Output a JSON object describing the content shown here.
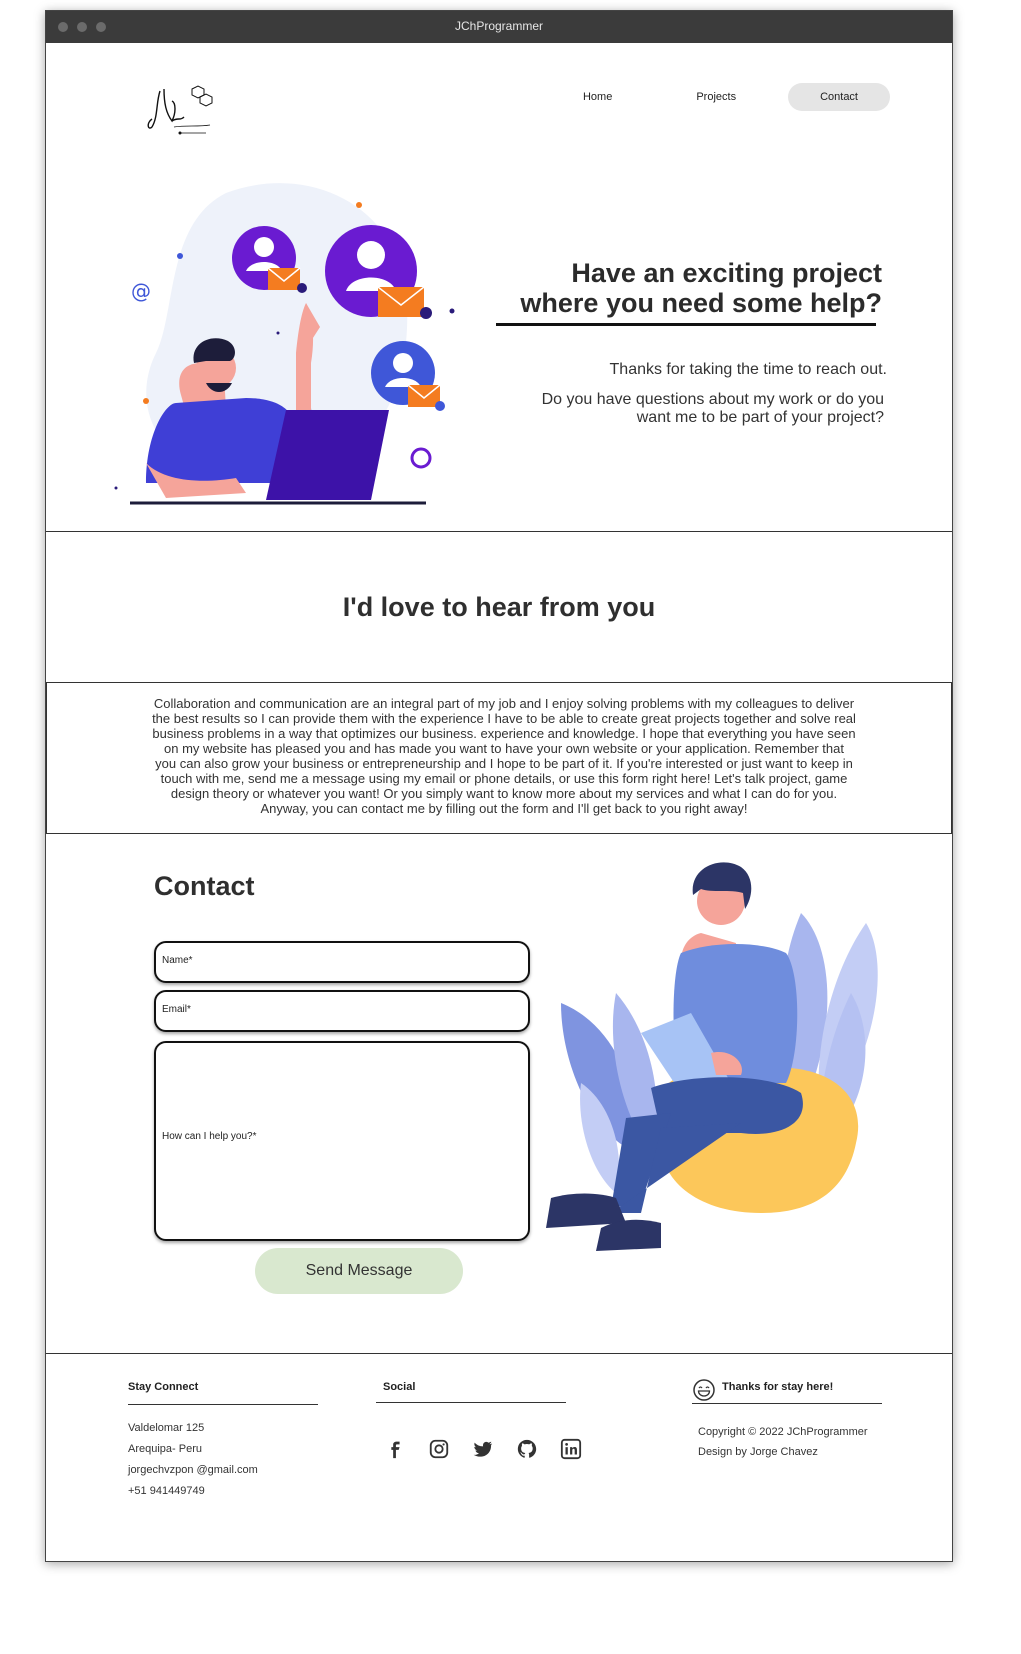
{
  "window": {
    "title": "JChProgrammer"
  },
  "nav": {
    "items": [
      {
        "label": "Home"
      },
      {
        "label": "Projects"
      },
      {
        "label": "Contact"
      }
    ]
  },
  "hero": {
    "title_line1": "Have an exciting project",
    "title_line2": "where you need some help?",
    "subtitle": "Thanks for taking the time to reach out.",
    "question": "Do you have questions about my work or do you want me to be part of your project?"
  },
  "intro": {
    "heading": "I'd love to hear from you",
    "paragraph": "Collaboration and communication are an integral part of my job and I enjoy solving problems with my colleagues to deliver the best results so I can provide them with the experience I have to be able to create great projects together and solve real business problems in a way that optimizes our business. experience and knowledge. I hope that everything you have seen on my website has pleased you and has made you want to have your own website or your application. Remember that you can also grow your business or entrepreneurship and I hope to be part of it. If you're interested or just want to keep in touch with me, send me a message using my email or phone details, or use this form right here! Let's talk project, game design theory or whatever you want! Or you simply want to know more about my services and what I can do for you. Anyway, you can contact me by filling out the form and I'll get back to you right away!"
  },
  "contact": {
    "heading": "Contact",
    "name_placeholder": "Name*",
    "email_placeholder": "Email*",
    "message_placeholder": "How can I help you?*",
    "send_label": "Send Message"
  },
  "footer": {
    "stay_connect": {
      "title": "Stay Connect",
      "address": "Valdelomar 125",
      "city": "Arequipa- Peru",
      "email": "jorgechvzpon @gmail.com",
      "phone": "+51 941449749"
    },
    "social": {
      "title": "Social",
      "icons": [
        "facebook-icon",
        "instagram-icon",
        "twitter-icon",
        "github-icon",
        "linkedin-icon"
      ]
    },
    "thanks": {
      "title": "Thanks for stay here!",
      "copyright": "Copyright ©  2022 JChProgrammer",
      "design": "Design by Jorge Chavez"
    }
  },
  "colors": {
    "nav_active_bg": "#e5e5e5",
    "send_button_bg": "#d9e8cf",
    "illustration_purple": "#6a1bd1",
    "illustration_blue": "#3f57d8",
    "illustration_orange": "#f47c20",
    "beanbag_yellow": "#fcc75a"
  }
}
